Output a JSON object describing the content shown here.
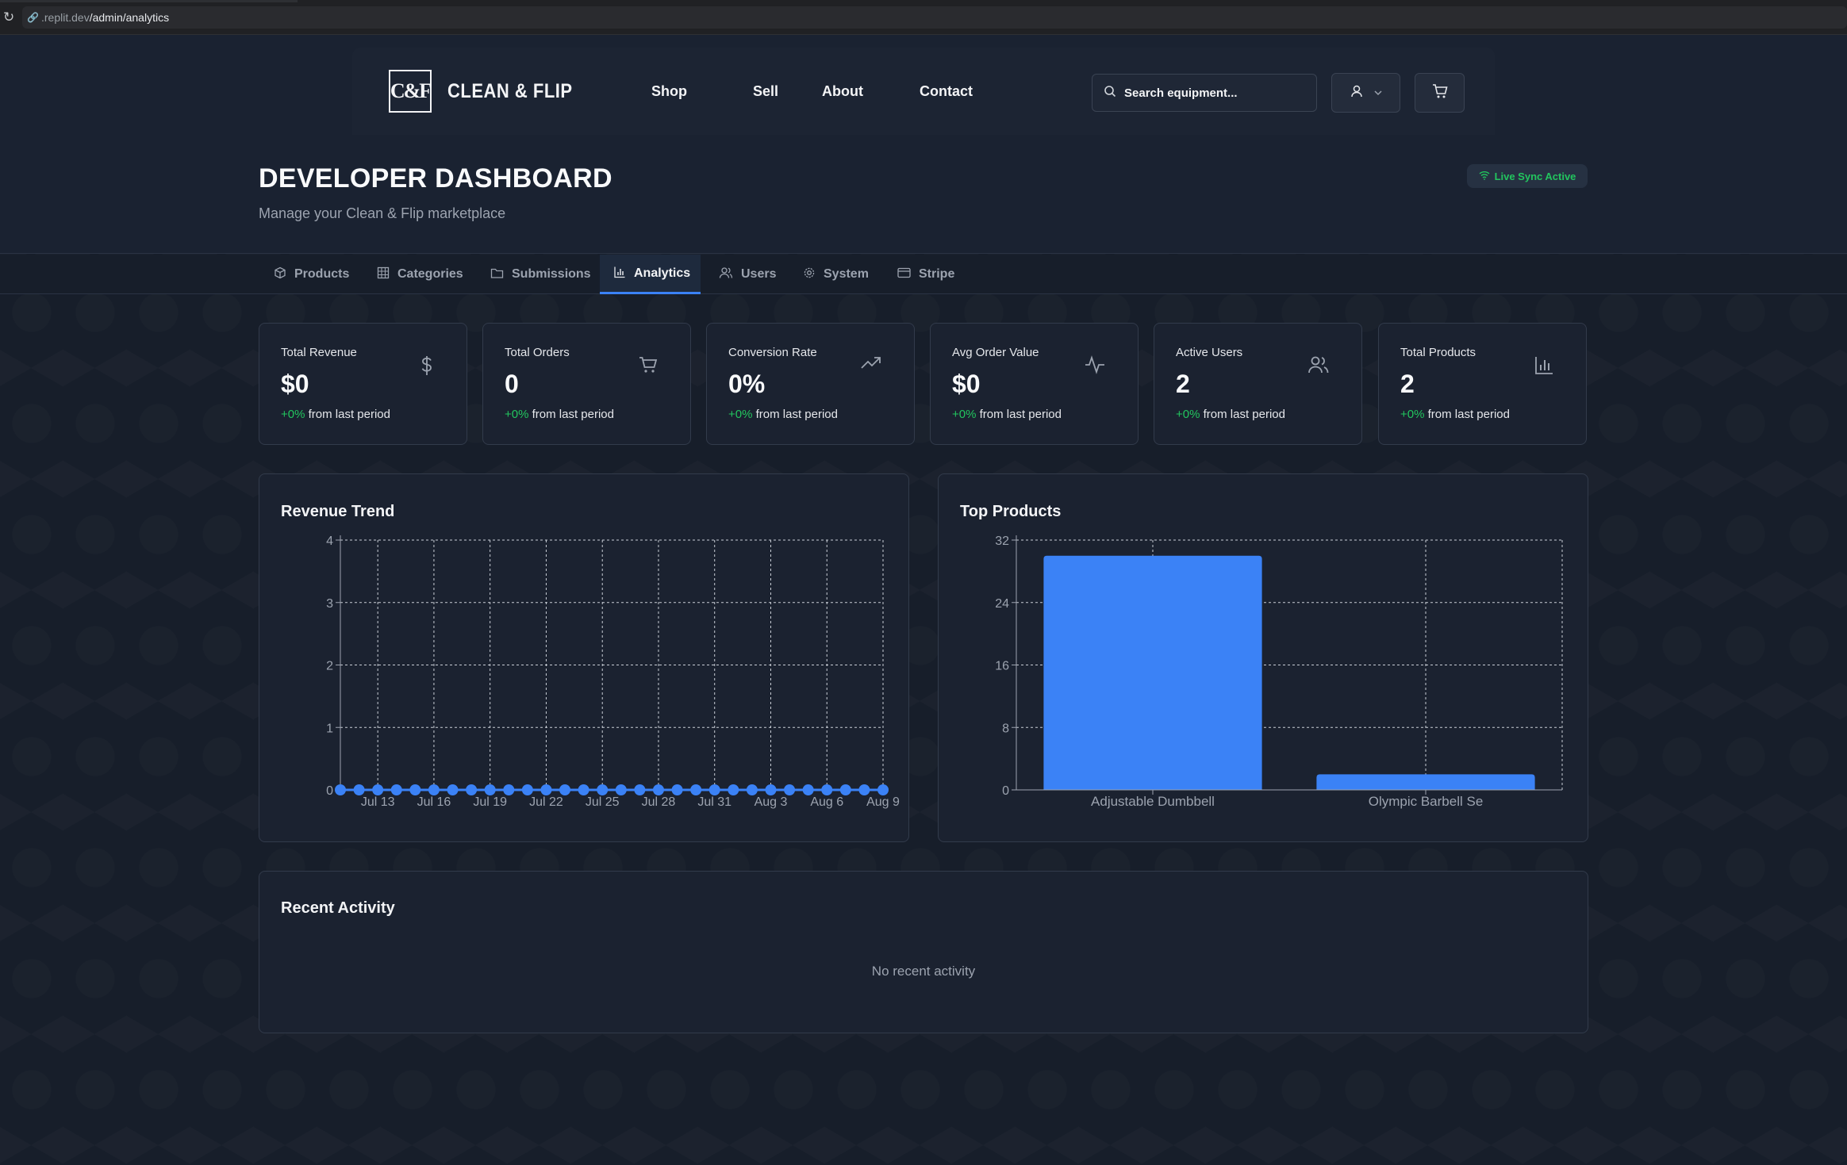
{
  "browser": {
    "url_prefix": ".replit.dev",
    "url_path": "/admin/analytics"
  },
  "brand": {
    "logo_mark": "C&F",
    "name": "CLEAN & FLIP"
  },
  "nav": {
    "links": [
      "Shop",
      "Sell",
      "About",
      "Contact"
    ]
  },
  "search": {
    "placeholder": "Search equipment..."
  },
  "page": {
    "title": "DEVELOPER DASHBOARD",
    "subtitle": "Manage your Clean & Flip marketplace",
    "live_badge": "Live Sync Active"
  },
  "tabs": [
    {
      "label": "Products",
      "icon": "package-icon"
    },
    {
      "label": "Categories",
      "icon": "grid-icon"
    },
    {
      "label": "Submissions",
      "icon": "folder-icon"
    },
    {
      "label": "Analytics",
      "icon": "bar-chart-icon",
      "active": true
    },
    {
      "label": "Users",
      "icon": "users-icon"
    },
    {
      "label": "System",
      "icon": "gear-icon"
    },
    {
      "label": "Stripe",
      "icon": "credit-card-icon"
    }
  ],
  "stats": [
    {
      "label": "Total Revenue",
      "value": "$0",
      "change": "+0%",
      "suffix": " from last period",
      "icon": "dollar-icon"
    },
    {
      "label": "Total Orders",
      "value": "0",
      "change": "+0%",
      "suffix": " from last period",
      "icon": "cart-icon"
    },
    {
      "label": "Conversion Rate",
      "value": "0%",
      "change": "+0%",
      "suffix": " from last period",
      "icon": "trending-up-icon"
    },
    {
      "label": "Avg Order Value",
      "value": "$0",
      "change": "+0%",
      "suffix": " from last period",
      "icon": "activity-icon"
    },
    {
      "label": "Active Users",
      "value": "2",
      "change": "+0%",
      "suffix": " from last period",
      "icon": "users-icon"
    },
    {
      "label": "Total Products",
      "value": "2",
      "change": "+0%",
      "suffix": " from last period",
      "icon": "bar-chart-icon"
    }
  ],
  "panels": {
    "revenue_title": "Revenue Trend",
    "products_title": "Top Products",
    "activity_title": "Recent Activity",
    "activity_empty": "No recent activity"
  },
  "colors": {
    "accent": "#3b82f6",
    "positive": "#22c55e"
  },
  "chart_data": [
    {
      "type": "line",
      "title": "Revenue Trend",
      "x": [
        "Jul 11",
        "Jul 12",
        "Jul 13",
        "Jul 14",
        "Jul 15",
        "Jul 16",
        "Jul 17",
        "Jul 18",
        "Jul 19",
        "Jul 20",
        "Jul 21",
        "Jul 22",
        "Jul 23",
        "Jul 24",
        "Jul 25",
        "Jul 26",
        "Jul 27",
        "Jul 28",
        "Jul 29",
        "Jul 30",
        "Jul 31",
        "Aug 1",
        "Aug 2",
        "Aug 3",
        "Aug 4",
        "Aug 5",
        "Aug 6",
        "Aug 7",
        "Aug 8",
        "Aug 9"
      ],
      "tick_labels": [
        "Jul 13",
        "Jul 16",
        "Jul 19",
        "Jul 22",
        "Jul 25",
        "Jul 28",
        "Jul 31",
        "Aug 3",
        "Aug 6",
        "Aug 9"
      ],
      "series": [
        {
          "values": [
            0,
            0,
            0,
            0,
            0,
            0,
            0,
            0,
            0,
            0,
            0,
            0,
            0,
            0,
            0,
            0,
            0,
            0,
            0,
            0,
            0,
            0,
            0,
            0,
            0,
            0,
            0,
            0,
            0,
            0
          ]
        }
      ],
      "ylim": [
        0,
        4
      ],
      "yticks": [
        0,
        1,
        2,
        3,
        4
      ],
      "grid": true
    },
    {
      "type": "bar",
      "title": "Top Products",
      "categories": [
        "Adjustable Dumbbell",
        "Olympic Barbell Se"
      ],
      "values": [
        30,
        2
      ],
      "ylim": [
        0,
        32
      ],
      "yticks": [
        0,
        8,
        16,
        24,
        32
      ],
      "grid": true
    }
  ]
}
